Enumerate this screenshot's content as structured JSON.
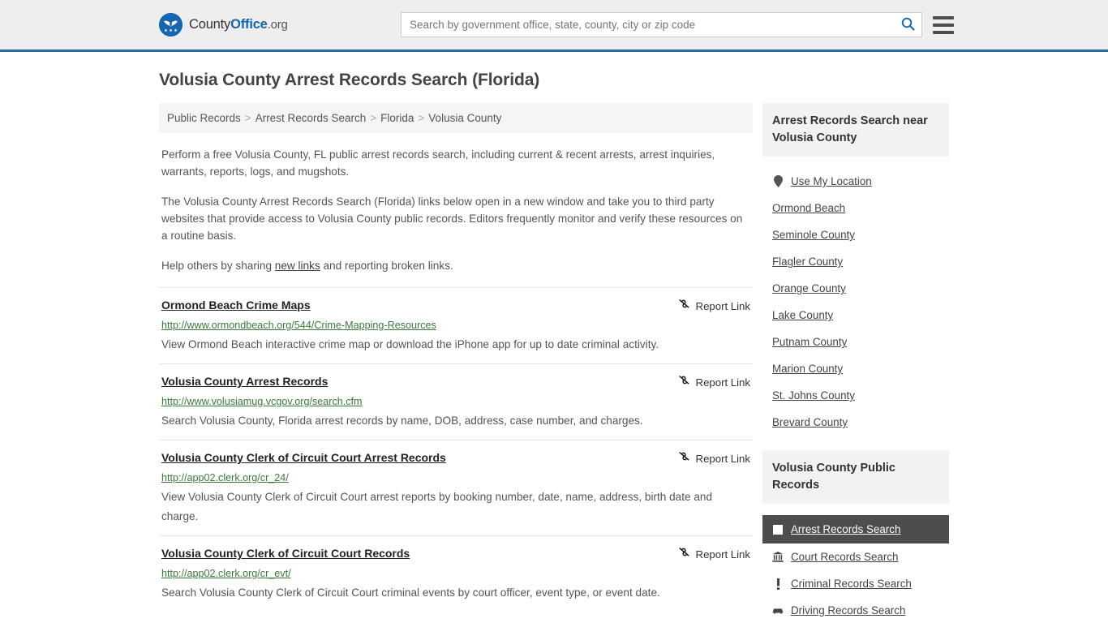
{
  "header": {
    "brand": {
      "part1": "County",
      "part2": "Office",
      "part3": ".org"
    },
    "search": {
      "placeholder": "Search by government office, state, county, city or zip code",
      "value": "",
      "icon": "search-icon"
    },
    "menu_icon": "hamburger-menu-icon"
  },
  "page_title": "Volusia County Arrest Records Search (Florida)",
  "breadcrumb": [
    "Public Records",
    "Arrest Records Search",
    "Florida",
    "Volusia County"
  ],
  "breadcrumb_separator": ">",
  "intro": {
    "p1": "Perform a free Volusia County, FL public arrest records search, including current & recent arrests, arrest inquiries, warrants, reports, logs, and mugshots.",
    "p2": "The Volusia County Arrest Records Search (Florida) links below open in a new window and take you to third party websites that provide access to Volusia County public records. Editors frequently monitor and verify these resources on a routine basis.",
    "p3_before": "Help others by sharing ",
    "p3_link": "new links",
    "p3_after": " and reporting broken links."
  },
  "report_link_label": "Report Link",
  "report_link_icon": "broken-link-icon",
  "results": [
    {
      "title": "Ormond Beach Crime Maps",
      "url": "http://www.ormondbeach.org/544/Crime-Mapping-Resources",
      "description": "View Ormond Beach interactive crime map or download the iPhone app for up to date criminal activity."
    },
    {
      "title": "Volusia County Arrest Records",
      "url": "http://www.volusiamug.vcgov.org/search.cfm",
      "description": "Search Volusia County, Florida arrest records by name, DOB, address, case number, and charges."
    },
    {
      "title": "Volusia County Clerk of Circuit Court Arrest Records",
      "url": "http://app02.clerk.org/cr_24/",
      "description": "View Volusia County Clerk of Circuit Court arrest reports by booking number, date, name, address, birth date and charge."
    },
    {
      "title": "Volusia County Clerk of Circuit Court Records",
      "url": "http://app02.clerk.org/cr_evt/",
      "description": "Search Volusia County Clerk of Circuit Court criminal events by court officer, event type, or event date."
    }
  ],
  "sidebar": {
    "nearby": {
      "heading": "Arrest Records Search near Volusia County",
      "items": [
        {
          "label": "Use My Location",
          "icon": "map-pin-icon"
        },
        {
          "label": "Ormond Beach",
          "icon": ""
        },
        {
          "label": "Seminole County",
          "icon": ""
        },
        {
          "label": "Flagler County",
          "icon": ""
        },
        {
          "label": "Orange County",
          "icon": ""
        },
        {
          "label": "Lake County",
          "icon": ""
        },
        {
          "label": "Putnam County",
          "icon": ""
        },
        {
          "label": "Marion County",
          "icon": ""
        },
        {
          "label": "St. Johns County",
          "icon": ""
        },
        {
          "label": "Brevard County",
          "icon": ""
        }
      ]
    },
    "public_records": {
      "heading": "Volusia County Public Records",
      "items": [
        {
          "label": "Arrest Records Search",
          "icon": "fingerprint-icon",
          "active": true
        },
        {
          "label": "Court Records Search",
          "icon": "courthouse-icon",
          "active": false
        },
        {
          "label": "Criminal Records Search",
          "icon": "exclamation-icon",
          "active": false
        },
        {
          "label": "Driving Records Search",
          "icon": "car-icon",
          "active": false
        }
      ]
    }
  },
  "colors": {
    "brand_blue": "#1565b0",
    "header_bg": "#eeeeee",
    "header_border": "#2b6ca3",
    "url_green": "#3a7a3a",
    "active_bg": "#4d4d4d",
    "panel_bg": "#f2f2f2"
  }
}
